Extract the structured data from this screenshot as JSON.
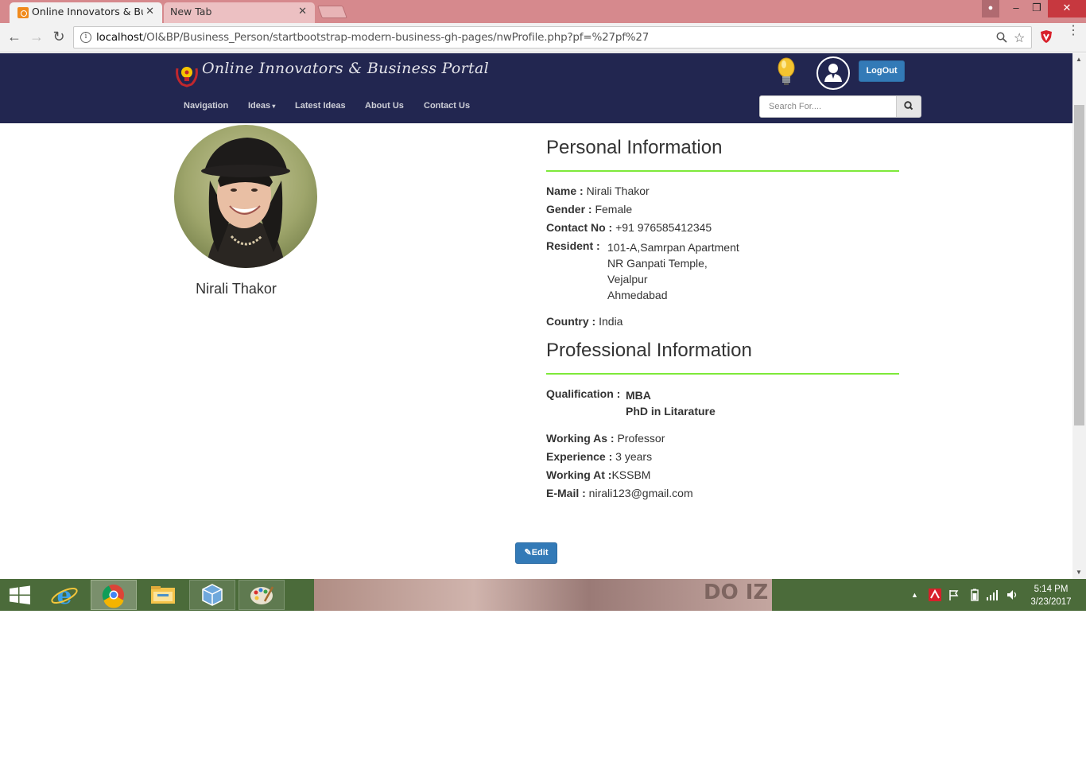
{
  "browser": {
    "tabs": [
      {
        "title": "Online Innovators & Busi",
        "active": true
      },
      {
        "title": "New Tab",
        "active": false
      }
    ],
    "tab_close": "✕",
    "url_host": "localhost",
    "url_path": "/OI&BP/Business_Person/startbootstrap-modern-business-gh-pages/nwProfile.php?pf=%27pf%27"
  },
  "site": {
    "title": "Online Innovators & Business Portal",
    "nav": [
      "Navigation",
      "Ideas",
      "Latest Ideas",
      "About Us",
      "Contact Us"
    ],
    "logout_label": "LogOut",
    "search_placeholder": "Search For...."
  },
  "profile": {
    "name": "Nirali Thakor",
    "personal_title": "Personal Information",
    "fields": {
      "name_label": "Name :",
      "name_value": "Nirali Thakor",
      "gender_label": "Gender :",
      "gender_value": "Female",
      "contact_label": "Contact No :",
      "contact_value": "+91 976585412345",
      "resident_label": "Resident :",
      "resident_lines": [
        "101-A,Samrpan Apartment",
        "NR Ganpati Temple,",
        "Vejalpur",
        "Ahmedabad"
      ],
      "country_label": "Country :",
      "country_value": "India"
    },
    "professional_title": "Professional Information",
    "professional": {
      "qualification_label": "Qualification :",
      "qualification_values": [
        "MBA",
        "PhD in Litarature"
      ],
      "working_as_label": "Working As :",
      "working_as_value": "Professor",
      "experience_label": "Experience :",
      "experience_value": "3 years",
      "working_at_label": "Working At :",
      "working_at_value": "KSSBM",
      "email_label": "E-Mail :",
      "email_value": "nirali123@gmail.com"
    },
    "edit_label": "Edit"
  },
  "taskbar": {
    "time": "5:14 PM",
    "date": "3/23/2017"
  },
  "colors": {
    "header_bg": "#222650",
    "accent_rule": "#7ee93a",
    "button_blue": "#337ab7",
    "tabstrip": "#d6898d",
    "taskbar": "#4b6b3a"
  }
}
